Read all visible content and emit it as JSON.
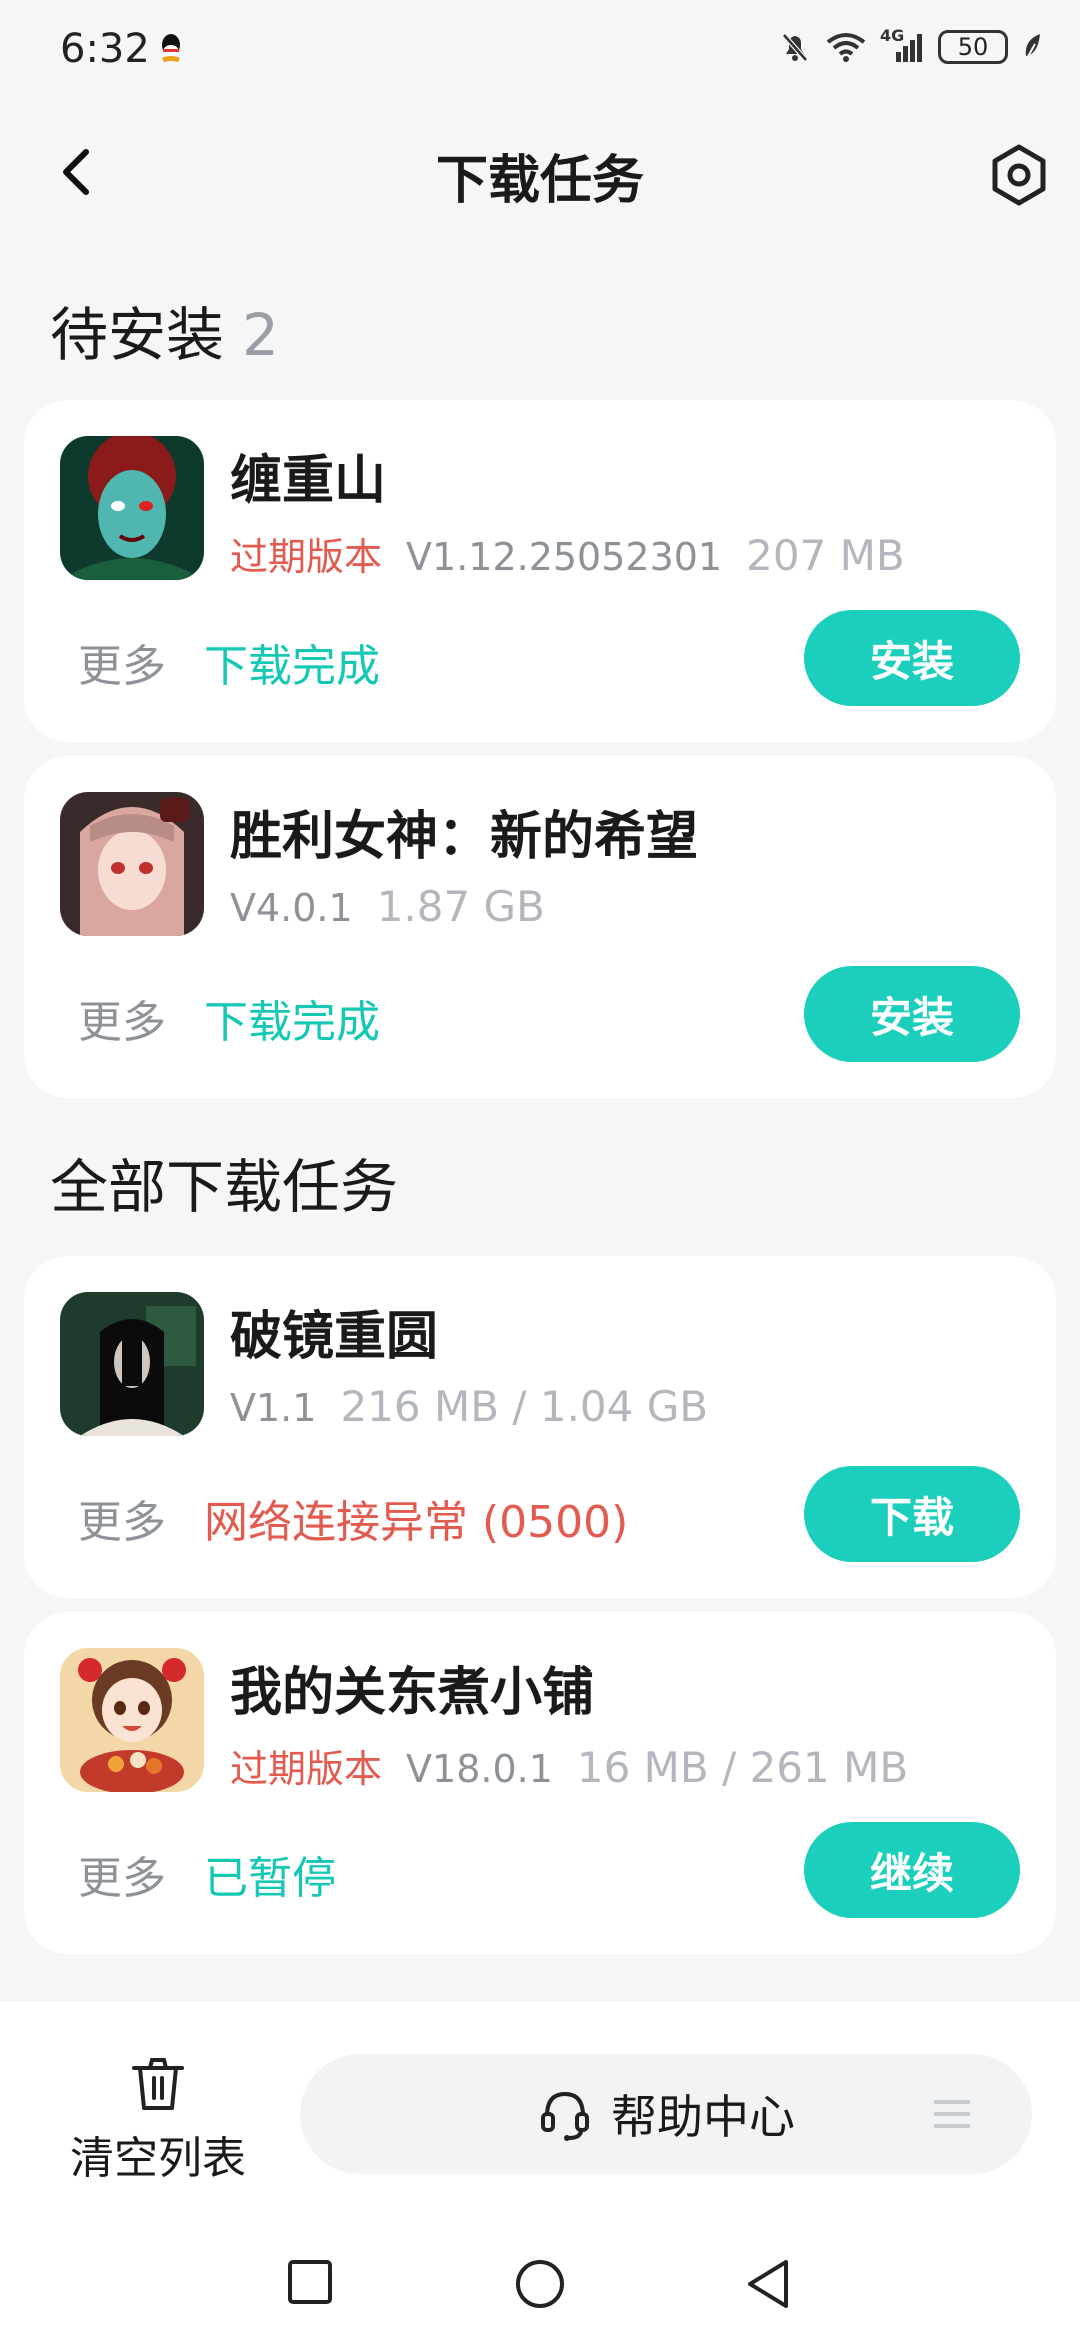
{
  "status_bar": {
    "time": "6:32",
    "network": "4G",
    "battery": "50",
    "icons": [
      "qq-icon",
      "mute-icon",
      "wifi-icon",
      "signal-icon",
      "battery-icon",
      "leaf-icon"
    ]
  },
  "header": {
    "title": "下载任务",
    "back_icon": "back-arrow-icon",
    "settings_icon": "settings-icon"
  },
  "pending_section": {
    "title": "待安装",
    "count": "2"
  },
  "all_section": {
    "title": "全部下载任务"
  },
  "pending": [
    {
      "name": "缠重山",
      "expired": "过期版本",
      "version": "V1.12.25052301",
      "size": "207 MB",
      "more": "更多",
      "status": "下载完成",
      "button": "安装"
    },
    {
      "name": "胜利女神：新的希望",
      "version": "V4.0.1",
      "size": "1.87 GB",
      "more": "更多",
      "status": "下载完成",
      "button": "安装"
    }
  ],
  "all": [
    {
      "name": "破镜重圆",
      "version": "V1.1",
      "size": "216 MB / 1.04 GB",
      "more": "更多",
      "status": "网络连接异常 (0500)",
      "button": "下载"
    },
    {
      "name": "我的关东煮小铺",
      "expired": "过期版本",
      "version": "V18.0.1",
      "size": "16 MB / 261 MB",
      "more": "更多",
      "status": "已暂停",
      "button": "继续"
    }
  ],
  "bottom": {
    "clear_label": "清空列表",
    "help_label": "帮助中心"
  },
  "colors": {
    "accent": "#1ccfbd",
    "status_ok": "#14c8b4",
    "status_error": "#e35a4f"
  }
}
